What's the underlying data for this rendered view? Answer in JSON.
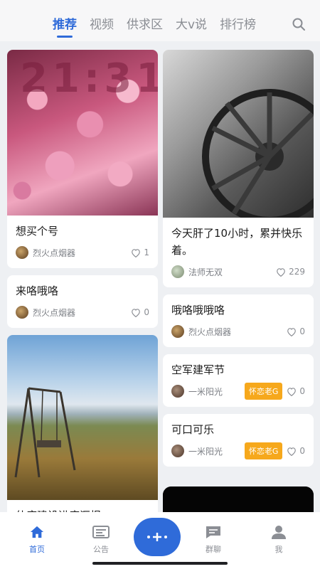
{
  "tabs": [
    "推荐",
    "视频",
    "供求区",
    "大v说",
    "排行榜"
  ],
  "active_tab": "推荐",
  "posts_left": [
    {
      "title": "想买个号",
      "author": "烈火点烟器",
      "likes": "1",
      "image": "pink-flowers-clock"
    },
    {
      "title": "来咯哦咯",
      "author": "烈火点烟器",
      "likes": "0"
    },
    {
      "title": "仙府建设进度汇报。",
      "image": "swing-by-lake"
    }
  ],
  "posts_right": [
    {
      "title": "今天肝了10小时，累并快乐着。",
      "author": "法师无双",
      "likes": "229",
      "image": "wagon-wheel"
    },
    {
      "title": "哦咯哦哦咯",
      "author": "烈火点烟器",
      "likes": "0"
    },
    {
      "title": "空军建军节",
      "author": "一米阳光",
      "badge": "怀恋老G",
      "likes": "0"
    },
    {
      "title": "可口可乐",
      "author": "一米阳光",
      "badge": "怀恋老G",
      "likes": "0"
    }
  ],
  "bottom_nav": [
    {
      "label": "首页",
      "icon": "home-icon"
    },
    {
      "label": "公告",
      "icon": "announcement-icon"
    },
    {
      "label": "群聊",
      "icon": "chat-icon"
    },
    {
      "label": "我",
      "icon": "profile-icon"
    }
  ],
  "colors": {
    "accent": "#2f6bd9",
    "badge": "#f6a81c"
  }
}
